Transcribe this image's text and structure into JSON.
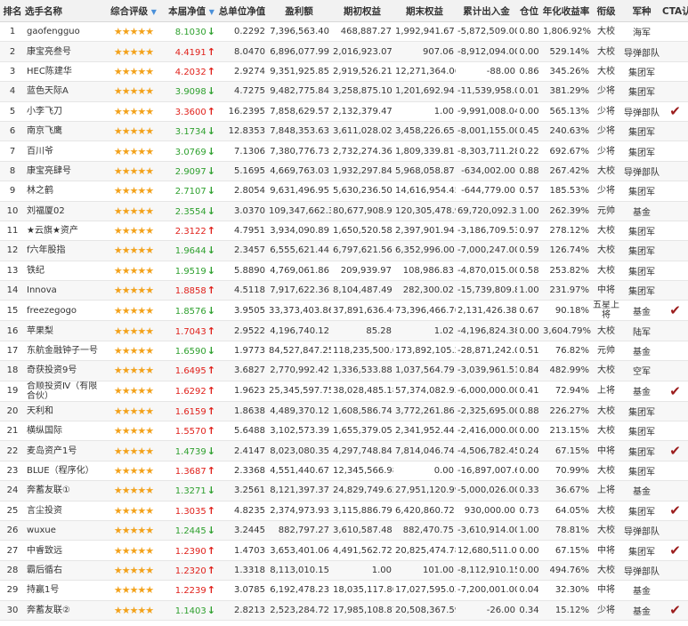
{
  "headers": {
    "rank": "排名",
    "name": "选手名称",
    "rating": "综合评级",
    "nav": "本届净值",
    "total_nav": "总单位净值",
    "profit": "盈利额",
    "start_equity": "期初权益",
    "end_equity": "期末权益",
    "flow": "累计出入金",
    "position": "仓位",
    "annual": "年化收益率",
    "rank_title": "衔级",
    "army": "军种",
    "cta": "CTA认证"
  },
  "rows": [
    {
      "rank": "1",
      "name": "gaofengguo",
      "stars": "★★★★★",
      "nav": "8.1030",
      "dir": "down",
      "total_nav": "0.2292",
      "profit": "7,396,563.40",
      "start": "468,887.27",
      "end": "1,992,941.67",
      "flow": "-5,872,509.00",
      "pos": "0.80",
      "annual": "1,806.92%",
      "title": "大校",
      "army": "海军",
      "cta": false
    },
    {
      "rank": "2",
      "name": "康宝亮叁号",
      "stars": "★★★★★",
      "nav": "4.4191",
      "dir": "up",
      "total_nav": "8.0470",
      "profit": "6,896,077.99",
      "start": "2,016,923.07",
      "end": "907.06",
      "flow": "-8,912,094.00",
      "pos": "0.00",
      "annual": "529.14%",
      "title": "大校",
      "army": "导弹部队",
      "cta": false
    },
    {
      "rank": "3",
      "name": "HEC陈建华",
      "stars": "★★★★★",
      "nav": "4.2032",
      "dir": "up",
      "total_nav": "2.9274",
      "profit": "9,351,925.85",
      "start": "2,919,526.21",
      "end": "12,271,364.06",
      "flow": "-88.00",
      "pos": "0.86",
      "annual": "345.26%",
      "title": "大校",
      "army": "集团军",
      "cta": false
    },
    {
      "rank": "4",
      "name": "蓝色天际A",
      "stars": "★★★★★",
      "nav": "3.9098",
      "dir": "down",
      "total_nav": "4.7275",
      "profit": "9,482,775.84",
      "start": "3,258,875.10",
      "end": "1,201,692.94",
      "flow": "-11,539,958.00",
      "pos": "0.01",
      "annual": "381.29%",
      "title": "少将",
      "army": "集团军",
      "cta": false
    },
    {
      "rank": "5",
      "name": "小李飞刀",
      "stars": "★★★★★",
      "nav": "3.3600",
      "dir": "up",
      "total_nav": "16.2395",
      "profit": "7,858,629.57",
      "start": "2,132,379.47",
      "end": "1.00",
      "flow": "-9,991,008.04",
      "pos": "0.00",
      "annual": "565.13%",
      "title": "少将",
      "army": "导弹部队",
      "cta": true
    },
    {
      "rank": "6",
      "name": "南京飞鹰",
      "stars": "★★★★★",
      "nav": "3.1734",
      "dir": "down",
      "total_nav": "12.8353",
      "profit": "7,848,353.63",
      "start": "3,611,028.02",
      "end": "3,458,226.65",
      "flow": "-8,001,155.00",
      "pos": "0.45",
      "annual": "240.63%",
      "title": "少将",
      "army": "集团军",
      "cta": false
    },
    {
      "rank": "7",
      "name": "百川爷",
      "stars": "★★★★★",
      "nav": "3.0769",
      "dir": "down",
      "total_nav": "7.1306",
      "profit": "7,380,776.73",
      "start": "2,732,274.36",
      "end": "1,809,339.81",
      "flow": "-8,303,711.28",
      "pos": "0.22",
      "annual": "692.67%",
      "title": "少将",
      "army": "集团军",
      "cta": false
    },
    {
      "rank": "8",
      "name": "康宝亮肆号",
      "stars": "★★★★★",
      "nav": "2.9097",
      "dir": "down",
      "total_nav": "5.1695",
      "profit": "4,669,763.03",
      "start": "1,932,297.84",
      "end": "5,968,058.87",
      "flow": "-634,002.00",
      "pos": "0.88",
      "annual": "267.42%",
      "title": "大校",
      "army": "导弹部队",
      "cta": false
    },
    {
      "rank": "9",
      "name": "林之鹤",
      "stars": "★★★★★",
      "nav": "2.7107",
      "dir": "down",
      "total_nav": "2.8054",
      "profit": "9,631,496.95",
      "start": "5,630,236.50",
      "end": "14,616,954.45",
      "flow": "-644,779.00",
      "pos": "0.57",
      "annual": "185.53%",
      "title": "少将",
      "army": "集团军",
      "cta": false
    },
    {
      "rank": "10",
      "name": "刘福厦02",
      "stars": "★★★★★",
      "nav": "2.3554",
      "dir": "down",
      "total_nav": "3.0370",
      "profit": "109,347,662.35",
      "start": "80,677,908.91",
      "end": "120,305,478.96",
      "flow": "69,720,092.30",
      "pos": "1.00",
      "annual": "262.39%",
      "title": "元帅",
      "army": "基金",
      "cta": false
    },
    {
      "rank": "11",
      "name": "★云旗★资产",
      "stars": "★★★★★",
      "nav": "2.3122",
      "dir": "up",
      "total_nav": "4.7951",
      "profit": "3,934,090.89",
      "start": "1,650,520.58",
      "end": "2,397,901.94",
      "flow": "-3,186,709.53",
      "pos": "0.97",
      "annual": "278.12%",
      "title": "大校",
      "army": "集团军",
      "cta": false
    },
    {
      "rank": "12",
      "name": "f六年股指",
      "stars": "★★★★★",
      "nav": "1.9644",
      "dir": "down",
      "total_nav": "2.3457",
      "profit": "6,555,621.44",
      "start": "6,797,621.56",
      "end": "6,352,996.00",
      "flow": "-7,000,247.00",
      "pos": "0.59",
      "annual": "126.74%",
      "title": "大校",
      "army": "集团军",
      "cta": false
    },
    {
      "rank": "13",
      "name": "铁纪",
      "stars": "★★★★★",
      "nav": "1.9519",
      "dir": "down",
      "total_nav": "5.8890",
      "profit": "4,769,061.86",
      "start": "209,939.97",
      "end": "108,986.83",
      "flow": "-4,870,015.00",
      "pos": "0.58",
      "annual": "253.82%",
      "title": "大校",
      "army": "集团军",
      "cta": false
    },
    {
      "rank": "14",
      "name": "Innova",
      "stars": "★★★★★",
      "nav": "1.8858",
      "dir": "up",
      "total_nav": "4.5118",
      "profit": "7,917,622.36",
      "start": "8,104,487.49",
      "end": "282,300.02",
      "flow": "-15,739,809.83",
      "pos": "1.00",
      "annual": "231.97%",
      "title": "中将",
      "army": "集团军",
      "cta": false
    },
    {
      "rank": "15",
      "name": "freezegogo",
      "stars": "★★★★★",
      "nav": "1.8576",
      "dir": "down",
      "total_nav": "3.9505",
      "profit": "33,373,403.86",
      "start": "37,891,636.46",
      "end": "73,396,466.70",
      "flow": "2,131,426.38",
      "pos": "0.67",
      "annual": "90.18%",
      "title": "五星上将",
      "army": "基金",
      "cta": true
    },
    {
      "rank": "16",
      "name": "苹果梨",
      "stars": "★★★★★",
      "nav": "1.7043",
      "dir": "up",
      "total_nav": "2.9522",
      "profit": "4,196,740.12",
      "start": "85.28",
      "end": "1.02",
      "flow": "-4,196,824.38",
      "pos": "0.00",
      "annual": "3,604.79%",
      "title": "大校",
      "army": "陆军",
      "cta": false
    },
    {
      "rank": "17",
      "name": "东航金融钟子一号",
      "stars": "★★★★★",
      "nav": "1.6590",
      "dir": "down",
      "total_nav": "1.9773",
      "profit": "84,527,847.25",
      "start": "118,235,500.01",
      "end": "173,892,105.26",
      "flow": "-28,871,242.00",
      "pos": "0.51",
      "annual": "76.82%",
      "title": "元帅",
      "army": "基金",
      "cta": false
    },
    {
      "rank": "18",
      "name": "奇获投资9号",
      "stars": "★★★★★",
      "nav": "1.6495",
      "dir": "up",
      "total_nav": "3.6827",
      "profit": "2,770,992.42",
      "start": "1,336,533.88",
      "end": "1,037,564.79",
      "flow": "-3,039,961.51",
      "pos": "0.84",
      "annual": "482.99%",
      "title": "大校",
      "army": "空军",
      "cta": false
    },
    {
      "rank": "19",
      "name": "合顺投资Ⅳ（有限合伙）",
      "stars": "★★★★★",
      "nav": "1.6292",
      "dir": "up",
      "total_nav": "1.9623",
      "profit": "25,345,597.75",
      "start": "38,028,485.18",
      "end": "57,374,082.93",
      "flow": "-6,000,000.00",
      "pos": "0.41",
      "annual": "72.94%",
      "title": "上将",
      "army": "基金",
      "cta": true
    },
    {
      "rank": "20",
      "name": "天利和",
      "stars": "★★★★★",
      "nav": "1.6159",
      "dir": "up",
      "total_nav": "1.8638",
      "profit": "4,489,370.12",
      "start": "1,608,586.74",
      "end": "3,772,261.86",
      "flow": "-2,325,695.00",
      "pos": "0.88",
      "annual": "226.27%",
      "title": "大校",
      "army": "集团军",
      "cta": false
    },
    {
      "rank": "21",
      "name": "横纵国际",
      "stars": "★★★★★",
      "nav": "1.5570",
      "dir": "up",
      "total_nav": "5.6488",
      "profit": "3,102,573.39",
      "start": "1,655,379.05",
      "end": "2,341,952.44",
      "flow": "-2,416,000.00",
      "pos": "0.00",
      "annual": "213.15%",
      "title": "大校",
      "army": "集团军",
      "cta": false
    },
    {
      "rank": "22",
      "name": "麦岛资产1号",
      "stars": "★★★★★",
      "nav": "1.4739",
      "dir": "down",
      "total_nav": "2.4147",
      "profit": "8,023,080.35",
      "start": "4,297,748.84",
      "end": "7,814,046.74",
      "flow": "-4,506,782.45",
      "pos": "0.24",
      "annual": "67.15%",
      "title": "中将",
      "army": "集团军",
      "cta": true
    },
    {
      "rank": "23",
      "name": "BLUE（程序化）",
      "stars": "★★★★★",
      "nav": "1.3687",
      "dir": "up",
      "total_nav": "2.3368",
      "profit": "4,551,440.67",
      "start": "12,345,566.98",
      "end": "0.00",
      "flow": "-16,897,007.65",
      "pos": "0.00",
      "annual": "70.99%",
      "title": "大校",
      "army": "集团军",
      "cta": false
    },
    {
      "rank": "24",
      "name": "奔蓄友联①",
      "stars": "★★★★★",
      "nav": "1.3271",
      "dir": "down",
      "total_nav": "3.2561",
      "profit": "8,121,397.37",
      "start": "24,829,749.62",
      "end": "27,951,120.99",
      "flow": "-5,000,026.00",
      "pos": "0.33",
      "annual": "36.67%",
      "title": "上将",
      "army": "基金",
      "cta": false
    },
    {
      "rank": "25",
      "name": "言尘投资",
      "stars": "★★★★★",
      "nav": "1.3035",
      "dir": "up",
      "total_nav": "4.8235",
      "profit": "2,374,973.93",
      "start": "3,115,886.79",
      "end": "6,420,860.72",
      "flow": "930,000.00",
      "pos": "0.73",
      "annual": "64.05%",
      "title": "大校",
      "army": "集团军",
      "cta": true
    },
    {
      "rank": "26",
      "name": "wuxue",
      "stars": "★★★★★",
      "nav": "1.2445",
      "dir": "down",
      "total_nav": "3.2445",
      "profit": "882,797.27",
      "start": "3,610,587.48",
      "end": "882,470.75",
      "flow": "-3,610,914.00",
      "pos": "1.00",
      "annual": "78.81%",
      "title": "大校",
      "army": "导弹部队",
      "cta": false
    },
    {
      "rank": "27",
      "name": "中睿致远",
      "stars": "★★★★★",
      "nav": "1.2390",
      "dir": "up",
      "total_nav": "1.4703",
      "profit": "3,653,401.06",
      "start": "4,491,562.72",
      "end": "20,825,474.78",
      "flow": "12,680,511.00",
      "pos": "0.00",
      "annual": "67.15%",
      "title": "中将",
      "army": "集团军",
      "cta": true
    },
    {
      "rank": "28",
      "name": "霸后循右",
      "stars": "★★★★★",
      "nav": "1.2320",
      "dir": "up",
      "total_nav": "1.3318",
      "profit": "8,113,010.15",
      "start": "1.00",
      "end": "101.00",
      "flow": "-8,112,910.15",
      "pos": "0.00",
      "annual": "494.76%",
      "title": "大校",
      "army": "导弹部队",
      "cta": false
    },
    {
      "rank": "29",
      "name": "持赢1号",
      "stars": "★★★★★",
      "nav": "1.2239",
      "dir": "up",
      "total_nav": "3.0785",
      "profit": "6,192,478.23",
      "start": "18,035,117.80",
      "end": "17,027,595.03",
      "flow": "-7,200,001.00",
      "pos": "0.04",
      "annual": "32.30%",
      "title": "中将",
      "army": "基金",
      "cta": false
    },
    {
      "rank": "30",
      "name": "奔蓄友联②",
      "stars": "★★★★★",
      "nav": "1.1403",
      "dir": "down",
      "total_nav": "2.8213",
      "profit": "2,523,284.72",
      "start": "17,985,108.87",
      "end": "20,508,367.59",
      "flow": "-26.00",
      "pos": "0.34",
      "annual": "15.12%",
      "title": "少将",
      "army": "基金",
      "cta": true
    }
  ],
  "colors": {
    "up": "#e0201a",
    "down": "#2ea02e",
    "star": "#f3a21b",
    "check": "#9b1c1c",
    "sort": "#4a90d9"
  },
  "icons": {
    "up": "arrow-up-icon",
    "down": "arrow-down-icon",
    "sort": "sort-desc-icon",
    "check": "cta-check-icon",
    "star": "star-icon"
  }
}
